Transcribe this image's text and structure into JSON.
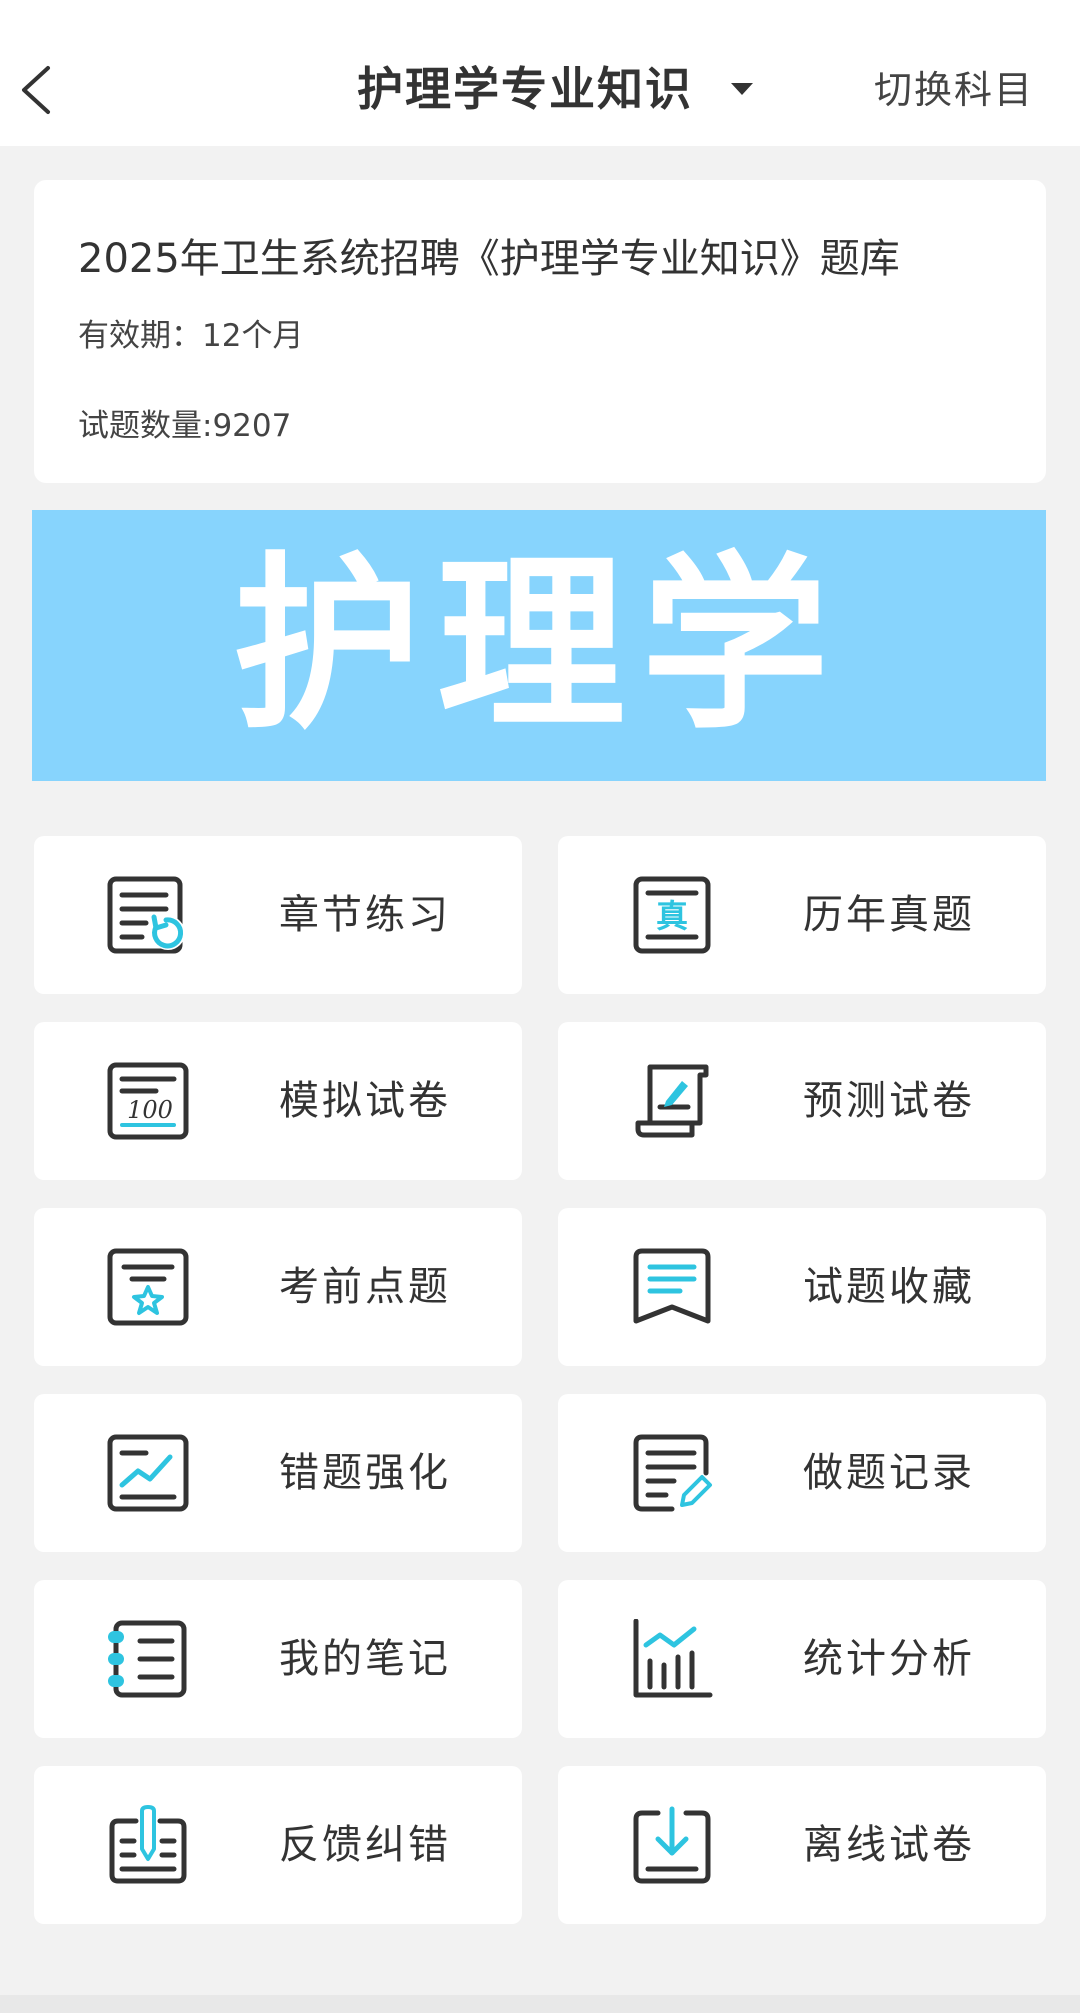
{
  "header": {
    "title": "护理学专业知识",
    "switch_label": "切换科目"
  },
  "info": {
    "title": "2025年卫生系统招聘《护理学专业知识》题库",
    "validity": "有效期：12个月",
    "count": "试题数量:9207"
  },
  "banner": {
    "text": "护理学",
    "color": "#87d4fd"
  },
  "colors": {
    "accent": "#2ec4e0",
    "icon_stroke": "#333333"
  },
  "menu": [
    {
      "label": "章节练习",
      "icon": "chapter-practice-icon"
    },
    {
      "label": "历年真题",
      "icon": "past-exam-icon"
    },
    {
      "label": "模拟试卷",
      "icon": "mock-exam-icon"
    },
    {
      "label": "预测试卷",
      "icon": "forecast-exam-icon"
    },
    {
      "label": "考前点题",
      "icon": "key-points-icon"
    },
    {
      "label": "试题收藏",
      "icon": "bookmark-icon"
    },
    {
      "label": "错题强化",
      "icon": "wrong-questions-icon"
    },
    {
      "label": "做题记录",
      "icon": "practice-record-icon"
    },
    {
      "label": "我的笔记",
      "icon": "notebook-icon"
    },
    {
      "label": "统计分析",
      "icon": "statistics-icon"
    },
    {
      "label": "反馈纠错",
      "icon": "feedback-icon"
    },
    {
      "label": "离线试卷",
      "icon": "download-icon"
    }
  ]
}
